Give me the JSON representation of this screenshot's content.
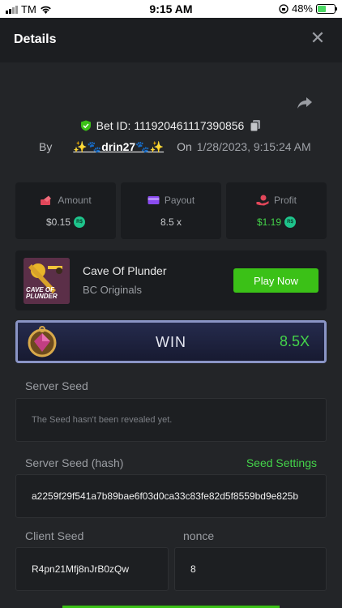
{
  "status_bar": {
    "carrier": "TM",
    "time": "9:15 AM",
    "battery": "48%"
  },
  "header": {
    "title": "Details",
    "close_icon": "close-icon"
  },
  "bet": {
    "bet_id_label": "Bet ID: 111920461117390856",
    "by_label": "By",
    "username": "✨🐾drin27🐾✨",
    "on_label": "On",
    "date": "1/28/2023, 9:15:24 AM"
  },
  "stats": {
    "amount_label": "Amount",
    "amount_value": "$0.15",
    "payout_label": "Payout",
    "payout_value": "8.5 x",
    "profit_label": "Profit",
    "profit_value": "$1.19",
    "coin_symbol": "R$"
  },
  "game": {
    "name": "Cave Of Plunder",
    "provider": "BC Originals",
    "thumb_text_1": "CAVE OF",
    "thumb_text_2": "PLUNDER",
    "play_label": "Play Now"
  },
  "result": {
    "label": "WIN",
    "multiplier": "8.5X"
  },
  "server_seed": {
    "label": "Server Seed",
    "value": "The Seed hasn't been revealed yet."
  },
  "server_seed_hash": {
    "label": "Server Seed (hash)",
    "settings_label": "Seed Settings",
    "value": "a2259f29f541a7b89bae6f03d0ca33c83fe82d5f8559bd9e825b"
  },
  "client_seed": {
    "label": "Client Seed",
    "value": "R4pn21Mfj8nJrB0zQw"
  },
  "nonce": {
    "label": "nonce",
    "value": "8"
  },
  "colors": {
    "accent_green": "#3bc117",
    "profit_green": "#44d44a",
    "background": "#232528"
  }
}
